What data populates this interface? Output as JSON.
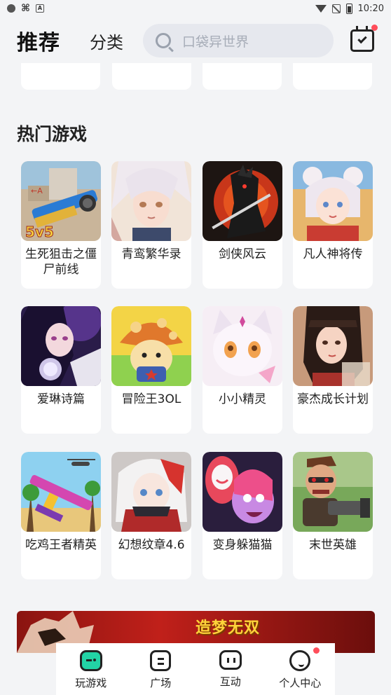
{
  "status_bar": {
    "time": "10:20",
    "notif_icon": "A"
  },
  "header": {
    "tab_recommend": "推荐",
    "tab_category": "分类",
    "search_placeholder": "口袋异世界"
  },
  "section": {
    "title": "热门游戏"
  },
  "games": [
    {
      "name": "生死狙击之僵尸前线"
    },
    {
      "name": "青鸾繁华录"
    },
    {
      "name": "剑侠风云"
    },
    {
      "name": "凡人神将传"
    },
    {
      "name": "爱琳诗篇"
    },
    {
      "name": "冒险王3OL"
    },
    {
      "name": "小小精灵"
    },
    {
      "name": "豪杰成长计划"
    },
    {
      "name": "吃鸡王者精英"
    },
    {
      "name": "幻想纹章4.6"
    },
    {
      "name": "变身躲猫猫"
    },
    {
      "name": "末世英雄"
    }
  ],
  "banner": {
    "text": "造梦无双"
  },
  "bottom_nav": [
    {
      "label": "玩游戏",
      "icon": "gamepad-icon",
      "active": true
    },
    {
      "label": "广场",
      "icon": "square-icon"
    },
    {
      "label": "互动",
      "icon": "chat-icon"
    },
    {
      "label": "个人中心",
      "icon": "person-icon",
      "badge": true
    }
  ],
  "colors": {
    "accent": "#22d3a5",
    "badge": "#ff4d5a",
    "background": "#f3f4f6"
  }
}
